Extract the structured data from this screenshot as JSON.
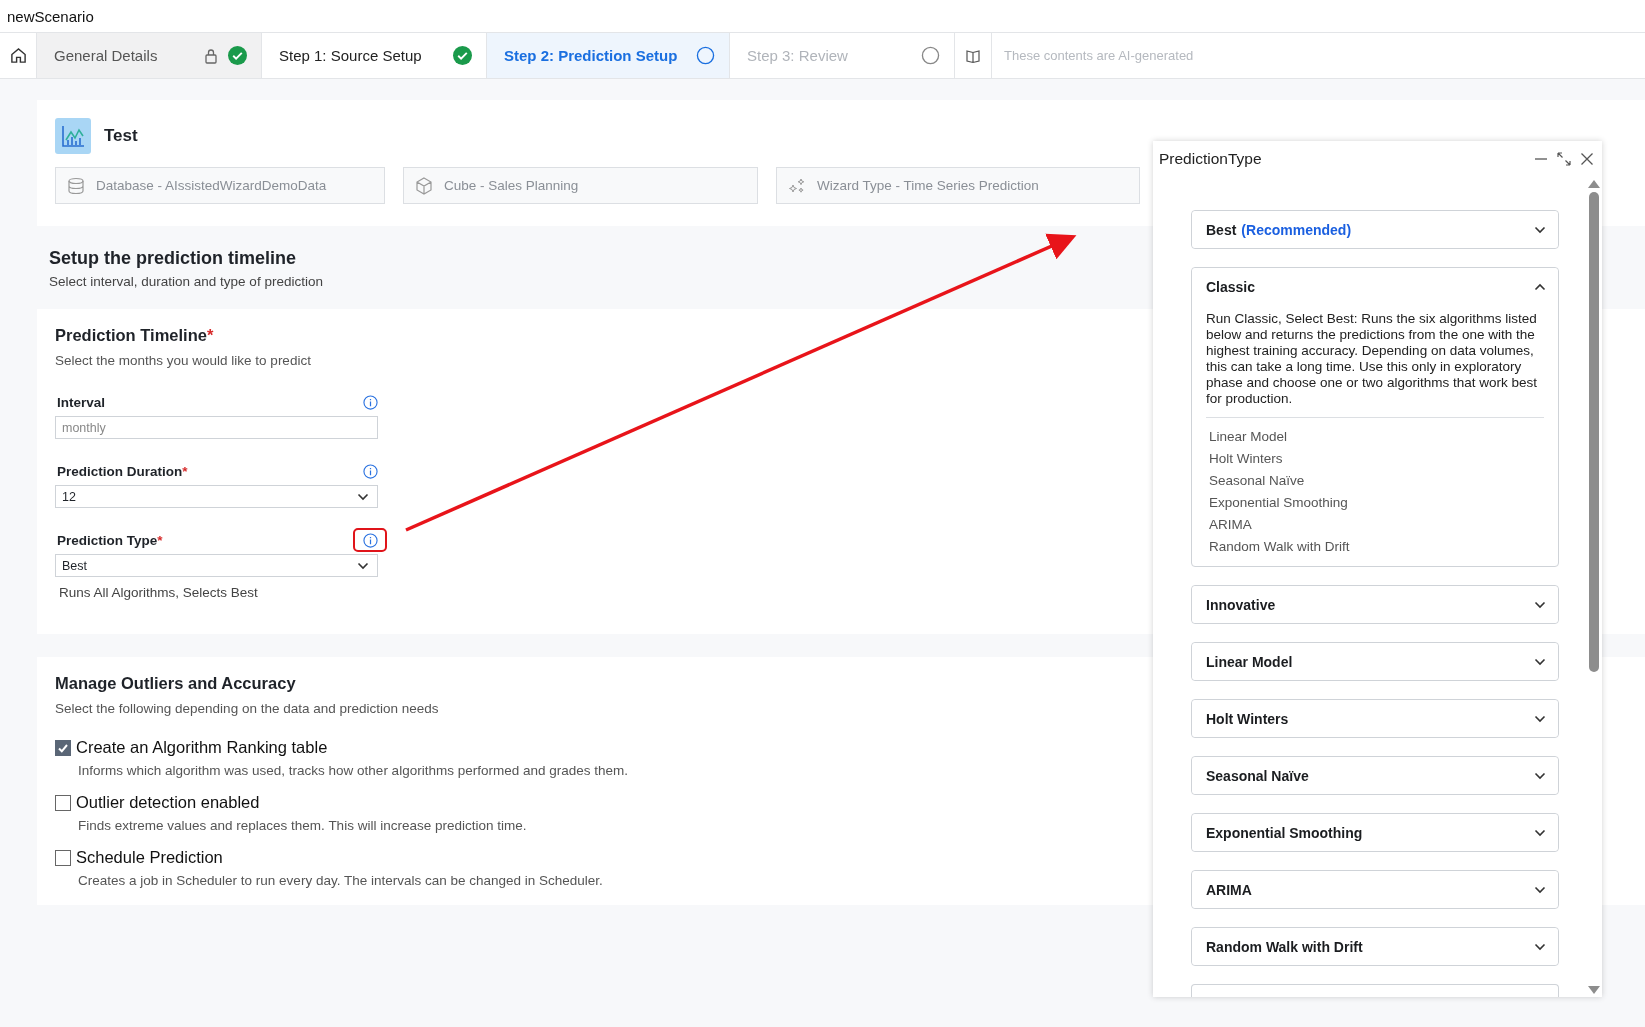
{
  "window": {
    "title": "newScenario"
  },
  "tabs": [
    {
      "label": "General Details",
      "locked": true,
      "completed": true,
      "disabled": false,
      "selected": false
    },
    {
      "label": "Step 1: Source Setup",
      "locked": false,
      "completed": true,
      "disabled": false,
      "selected": false
    },
    {
      "label": "Step 2: Prediction Setup",
      "locked": false,
      "completed": false,
      "disabled": false,
      "selected": true
    },
    {
      "label": "Step 3: Review",
      "locked": false,
      "completed": false,
      "disabled": true,
      "selected": false
    }
  ],
  "ai_notice": "These contents are AI-generated",
  "header": {
    "title": "Test",
    "chips": [
      {
        "kind": "database",
        "label": "Database - AIssistedWizardDemoData"
      },
      {
        "kind": "cube",
        "label": "Cube - Sales Planning"
      },
      {
        "kind": "sparkle",
        "label": "Wizard Type - Time Series Prediction"
      }
    ]
  },
  "section": {
    "title": "Setup the prediction timeline",
    "subtitle": "Select interval, duration and type of prediction"
  },
  "timeline": {
    "title": "Prediction Timeline",
    "required_mark": "*",
    "subtitle": "Select the months you would like to predict",
    "fields": [
      {
        "kind": "text",
        "label": "Interval",
        "value": "monthly",
        "disabled": true,
        "highlighted": false
      },
      {
        "kind": "select",
        "label": "Prediction Duration",
        "required_mark": "*",
        "value": "12",
        "disabled": false,
        "highlighted": false
      },
      {
        "kind": "select",
        "label": "Prediction Type",
        "required_mark": "*",
        "value": "Best",
        "disabled": false,
        "highlighted": true,
        "hint": "Runs All Algorithms, Selects Best"
      }
    ]
  },
  "outliers": {
    "title": "Manage Outliers and Accuracy",
    "subtitle": "Select the following depending on the data and prediction needs",
    "options": [
      {
        "label": "Create an Algorithm Ranking table",
        "checked": true,
        "description": "Informs which algorithm was used, tracks how other algorithms performed and grades them."
      },
      {
        "label": "Outlier detection enabled",
        "checked": false,
        "description": "Finds extreme values and replaces them. This will increase prediction time."
      },
      {
        "label": "Schedule Prediction",
        "checked": false,
        "description": "Creates a job in Scheduler to run every day. The intervals can be changed in Scheduler."
      }
    ]
  },
  "panel": {
    "title": "PredictionType",
    "items": [
      {
        "title": "Best",
        "tag": "(Recommended)",
        "expanded": false
      },
      {
        "title": "Classic",
        "expanded": true,
        "description": "Run Classic, Select Best: Runs the six algorithms listed below and returns the predictions from the one with the highest training accuracy. Depending on data volumes, this can take a long time. Use this only in exploratory phase and choose one or two algorithms that work best for production.",
        "algorithms": [
          "Linear Model",
          "Holt Winters",
          "Seasonal Naïve",
          "Exponential Smoothing",
          "ARIMA",
          "Random Walk with Drift"
        ]
      },
      {
        "title": "Innovative",
        "expanded": false
      },
      {
        "title": "Linear Model",
        "expanded": false
      },
      {
        "title": "Holt Winters",
        "expanded": false
      },
      {
        "title": "Seasonal Naïve",
        "expanded": false
      },
      {
        "title": "Exponential Smoothing",
        "expanded": false
      },
      {
        "title": "ARIMA",
        "expanded": false
      },
      {
        "title": "Random Walk with Drift",
        "expanded": false
      }
    ]
  }
}
